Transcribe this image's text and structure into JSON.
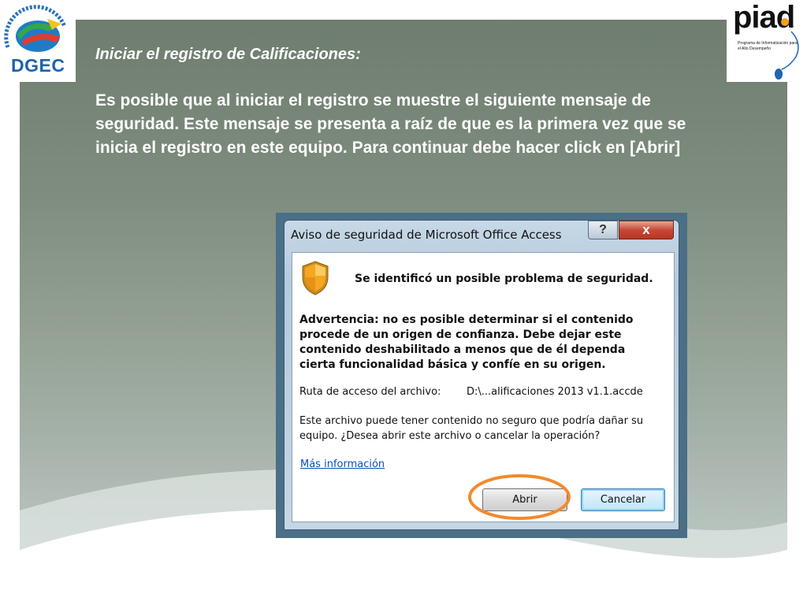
{
  "slide": {
    "title": "Iniciar el registro de Calificaciones:",
    "body": "Es posible que al iniciar el registro se muestre el siguiente mensaje de seguridad. Este mensaje se presenta a raíz de que es la primera vez que se inicia el registro en este equipo.  Para continuar debe hacer click en [Abrir]"
  },
  "logos": {
    "left_text": "DGEC",
    "right_text": "piad",
    "right_subtitle": "Programa de Informatización para el Alto Desempeño"
  },
  "dialog": {
    "title": "Aviso de seguridad de Microsoft Office Access",
    "help_icon": "?",
    "close_icon": "x",
    "headline": "Se identificó un posible problema de seguridad.",
    "warning": "Advertencia: no es posible determinar si el contenido procede de un origen de confianza. Debe dejar este contenido deshabilitado a menos que de él dependa cierta funcionalidad básica y confíe en su origen.",
    "path_label": "Ruta de acceso del archivo:",
    "path_value": "D:\\...alificaciones 2013 v1.1.accde",
    "info": "Este archivo puede tener contenido no seguro que podría dañar su equipo. ¿Desea abrir este archivo o cancelar la operación?",
    "more_info_link": "Más información",
    "open_button": "Abrir",
    "cancel_button": "Cancelar"
  },
  "colors": {
    "highlight": "#f28a2e",
    "link": "#0a50b8",
    "shield": "#f5a623",
    "slide_text": "#ffffff"
  },
  "icons": {
    "shield": "security-shield-icon",
    "help": "help-icon",
    "close": "close-icon"
  }
}
